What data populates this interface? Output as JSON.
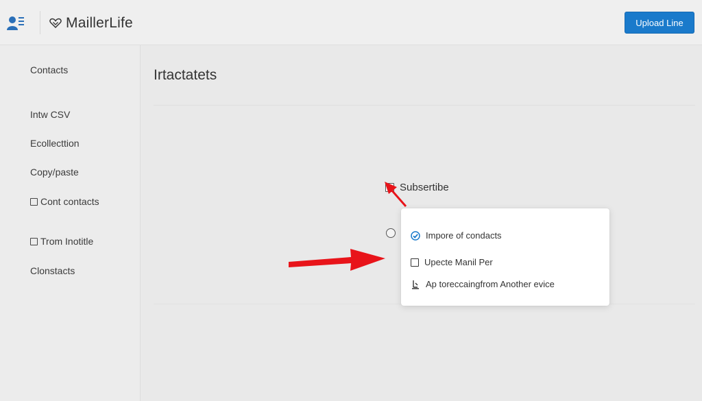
{
  "header": {
    "brand_name": "MaillerLife",
    "upload_label": "Upload Line"
  },
  "sidebar": {
    "items": [
      {
        "label": "Contacts"
      },
      {
        "label": "Intw CSV"
      },
      {
        "label": "Ecollecttion"
      },
      {
        "label": "Copy/paste"
      },
      {
        "label": "Cont contacts"
      },
      {
        "label": "Trom Inotitle"
      },
      {
        "label": "Clonstacts"
      }
    ]
  },
  "main": {
    "title": "Irtactatets",
    "subscribe_label": "Subsertibe"
  },
  "popup": {
    "options": [
      {
        "label": "Impore of condacts",
        "checked": true
      },
      {
        "label": "Upecte Manil Per",
        "checked": false
      },
      {
        "label": "Ap toreccaingfrom Another evice"
      }
    ]
  },
  "colors": {
    "accent": "#1a7acb",
    "annotation_arrow": "#e8141a",
    "check": "#1a7acb"
  },
  "icons": [
    "user-list-icon",
    "heart-logo-icon",
    "checkbox-checked-icon",
    "checkbox-empty-icon",
    "device-icon"
  ]
}
